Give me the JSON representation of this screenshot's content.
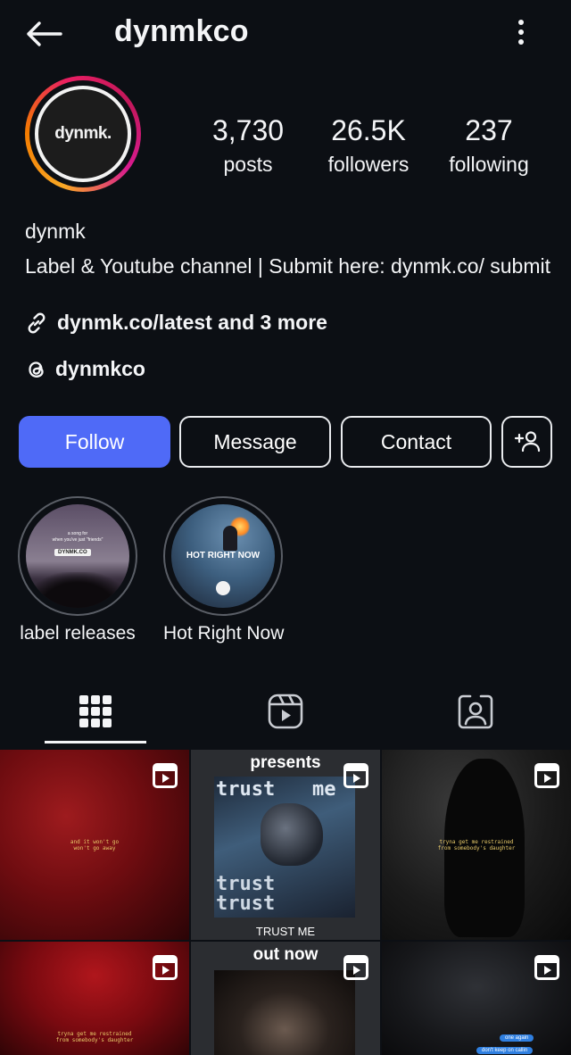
{
  "header": {
    "username": "dynmkco"
  },
  "avatar": {
    "text": "dynmk."
  },
  "stats": [
    {
      "value": "3,730",
      "label": "posts"
    },
    {
      "value": "26.5K",
      "label": "followers"
    },
    {
      "value": "237",
      "label": "following"
    }
  ],
  "bio": {
    "name": "dynmk",
    "text": "Label & Youtube channel | Submit here: dynmk.co/ submit",
    "link": "dynmk.co/latest and 3 more",
    "threads": "dynmkco"
  },
  "buttons": {
    "follow": "Follow",
    "message": "Message",
    "contact": "Contact"
  },
  "highlights": [
    {
      "label": "label releases",
      "caption_top": "a song for",
      "caption_sub": "when you've just \"friends\"",
      "tag": "DYNMK.CO"
    },
    {
      "label": "Hot Right Now",
      "title": "HOT RIGHT NOW"
    }
  ],
  "posts": [
    {
      "caption": "and it won't go\nwon't go away"
    },
    {
      "top": "presents",
      "word": "trust",
      "word2": "me",
      "bottom": "TRUST ME"
    },
    {
      "caption": "tryna get me restrained\nfrom somebody's daughter"
    },
    {
      "caption": "tryna get me restrained\nfrom somebody's daughter"
    },
    {
      "top": "out now"
    },
    {
      "bubble1": "one again",
      "bubble2": "don't keep on callin"
    }
  ],
  "colors": {
    "accent": "#4f6af7",
    "background": "#0c0f14",
    "text": "#f4f5f7"
  },
  "icons": [
    "back-arrow-icon",
    "more-vertical-icon",
    "link-icon",
    "threads-icon",
    "add-user-icon",
    "grid-icon",
    "reels-icon",
    "tagged-icon",
    "reel-badge-icon"
  ]
}
